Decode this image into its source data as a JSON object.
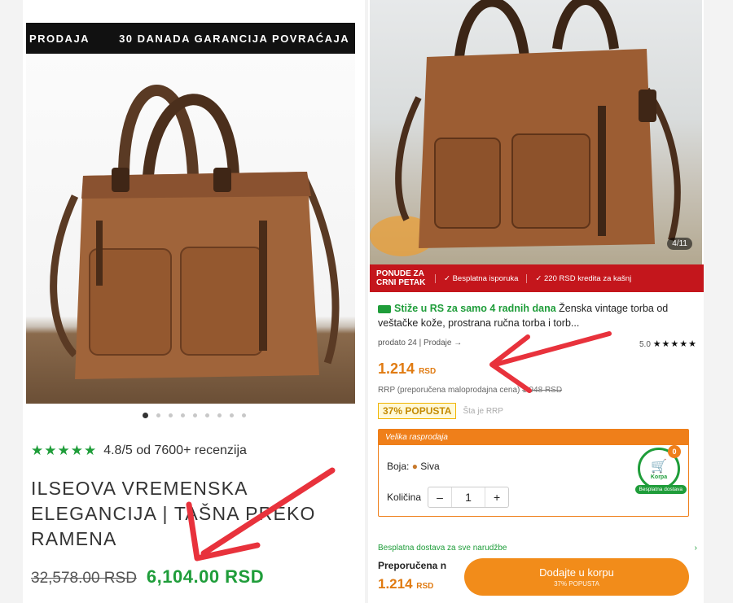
{
  "left_card": {
    "promo_texts": [
      "PRODAJA",
      "30 DANADA GARANCIJA POVRAĆAJA"
    ],
    "carousel_dot_count": 9,
    "carousel_active_index": 0,
    "rating_stars": "★★★★★",
    "rating_text": "4.8/5 od 7600+ recenzija",
    "title": "ILSEOVA VREMENSKA ELEGANCIJA | TAŠNA PREKO RAMENA",
    "old_price": "32,578.00 RSD",
    "new_price": "6,104.00 RSD"
  },
  "right_card": {
    "image_counter": "4/11",
    "deal_title": "PONUDE ZA CRNI PETAK",
    "deal_items": [
      "✓ Besplatna isporuka",
      "✓ 220 RSD kredita za kašnj"
    ],
    "delivery_prefix": "Stiže u RS za samo 4 radnih dana",
    "product_desc": " Ženska vintage torba od veštačke kože, prostrana ručna torba i torb...",
    "sold_text": "prodato 24 | Prodaje →",
    "rating_value": "5.0",
    "rating_stars": "★★★★★",
    "price_value": "1.214",
    "price_currency": "RSD",
    "rrp_label": "RRP (preporučena maloprodajna cena)",
    "rrp_value": "1.948 RSD",
    "discount_badge": "37% POPUSTA",
    "rrp_link": "Šta je RRP",
    "sale_header": "Velika rasprodaja",
    "color_label": "Boja:",
    "color_value": "Siva",
    "qty_label": "Količina",
    "qty_value": "1",
    "qty_minus": "–",
    "qty_plus": "+",
    "cart_badge_label": "Korpa",
    "cart_count": "0",
    "free_ship_tag": "Besplatna dostava",
    "free_delivery_line": "Besplatna dostava za sve narudžbe",
    "bottom_label": "Preporučena n",
    "bottom_price": "1.214",
    "bottom_currency": "RSD",
    "add_to_cart": "Dodajte u korpu",
    "add_to_cart_sub": "37% POPUSTA"
  },
  "colors": {
    "annotation_arrow": "#e8323c",
    "accent_green": "#1f9d3a",
    "accent_orange": "#ef7f1a",
    "deal_red": "#c4161c"
  }
}
